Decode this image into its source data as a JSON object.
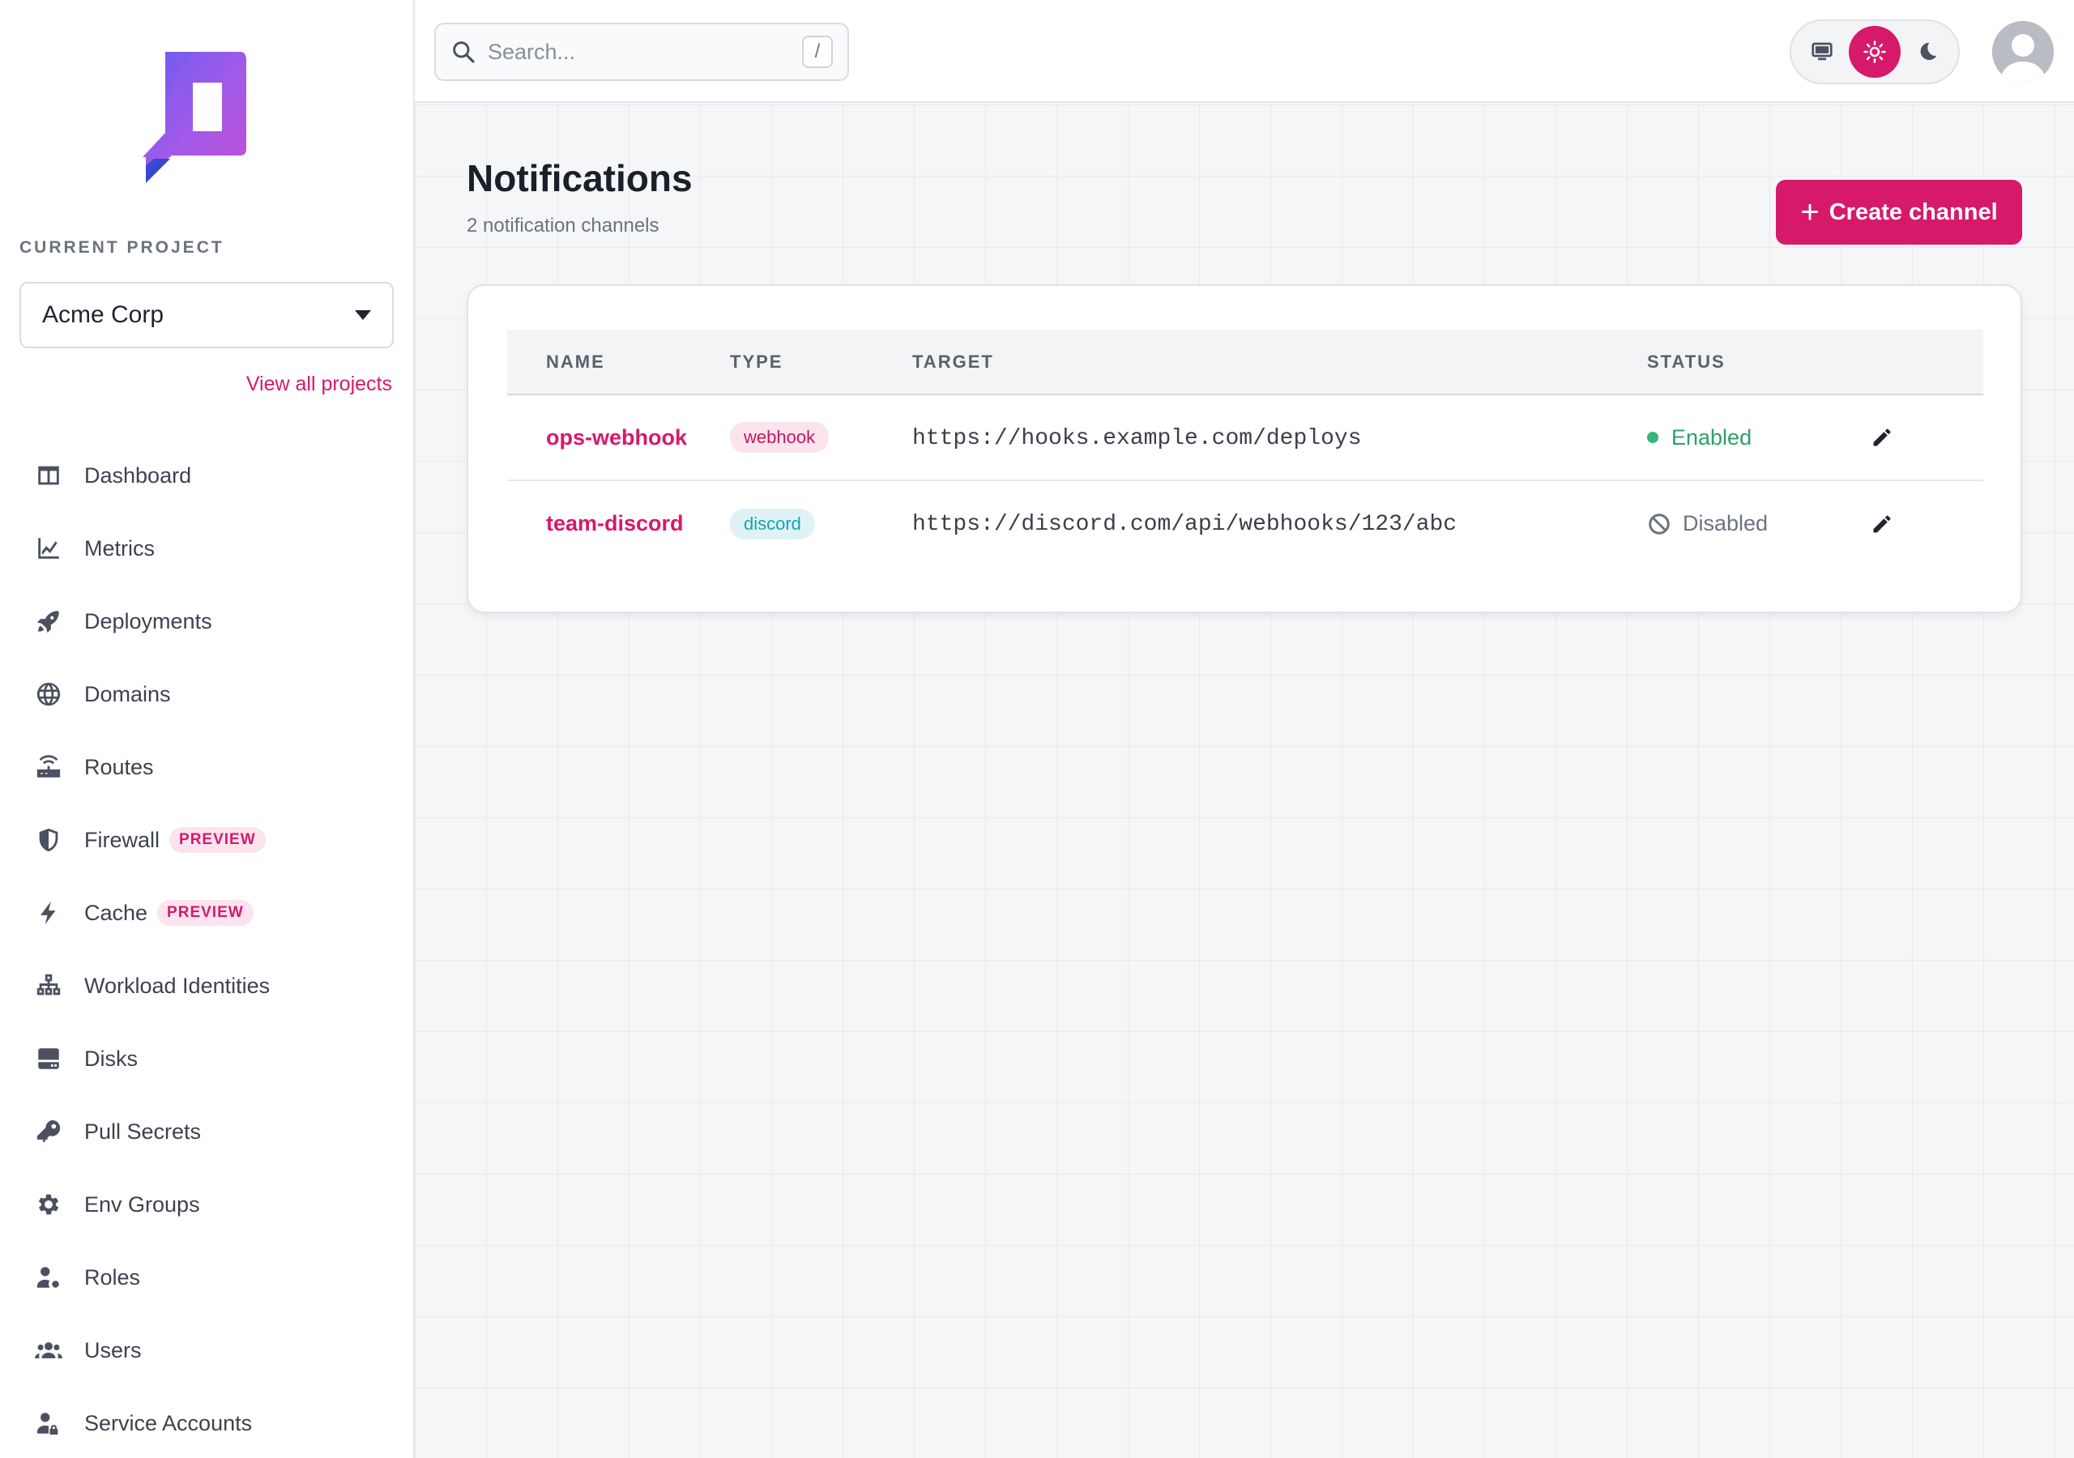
{
  "sidebar": {
    "section_label": "CURRENT PROJECT",
    "project": "Acme Corp",
    "view_all": "View all projects",
    "nav": [
      {
        "label": "Dashboard",
        "icon": "dashboard-icon"
      },
      {
        "label": "Metrics",
        "icon": "chart-line-icon"
      },
      {
        "label": "Deployments",
        "icon": "rocket-icon"
      },
      {
        "label": "Domains",
        "icon": "globe-icon"
      },
      {
        "label": "Routes",
        "icon": "router-icon"
      },
      {
        "label": "Firewall",
        "icon": "shield-icon",
        "badge": "PREVIEW"
      },
      {
        "label": "Cache",
        "icon": "bolt-icon",
        "badge": "PREVIEW"
      },
      {
        "label": "Workload Identities",
        "icon": "network-icon"
      },
      {
        "label": "Disks",
        "icon": "disk-icon"
      },
      {
        "label": "Pull Secrets",
        "icon": "key-icon"
      },
      {
        "label": "Env Groups",
        "icon": "gear-icon"
      },
      {
        "label": "Roles",
        "icon": "user-role-icon"
      },
      {
        "label": "Users",
        "icon": "users-icon"
      },
      {
        "label": "Service Accounts",
        "icon": "user-lock-icon"
      }
    ]
  },
  "topbar": {
    "search_placeholder": "Search...",
    "search_shortcut": "/",
    "theme_options": [
      "system",
      "light",
      "dark"
    ],
    "theme_active": "light"
  },
  "main": {
    "title": "Notifications",
    "subtitle": "2 notification channels",
    "create_label": "Create channel",
    "table": {
      "headers": {
        "name": "NAME",
        "type": "TYPE",
        "target": "TARGET",
        "status": "STATUS"
      },
      "rows": [
        {
          "name": "ops-webhook",
          "type": "webhook",
          "target": "https://hooks.example.com/deploys",
          "status": "Enabled"
        },
        {
          "name": "team-discord",
          "type": "discord",
          "target": "https://discord.com/api/webhooks/123/abc",
          "status": "Disabled"
        }
      ]
    }
  },
  "colors": {
    "accent": "#d6196b",
    "enabled": "#2e9f69",
    "webhook_badge_bg": "#fce4ef",
    "discord_badge_bg": "#dff3f6"
  }
}
